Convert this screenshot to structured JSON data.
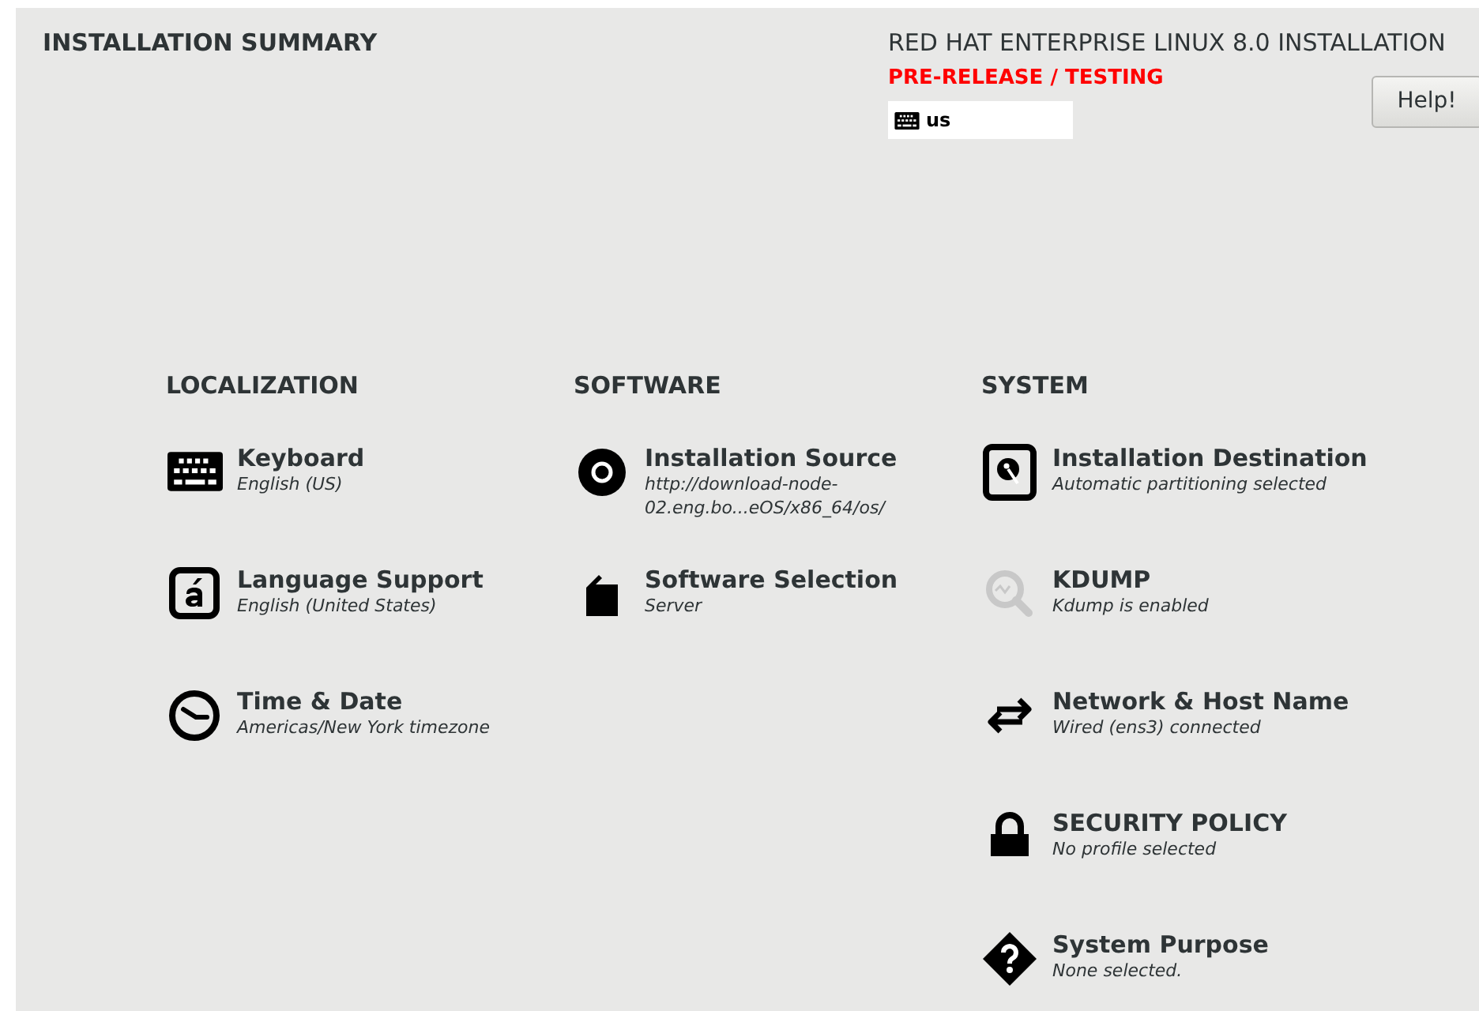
{
  "header": {
    "title": "INSTALLATION SUMMARY",
    "product": "RED HAT ENTERPRISE LINUX 8.0 INSTALLATION",
    "prerelease": "PRE-RELEASE / TESTING",
    "keyboard_layout": "us",
    "help_button": "Help!"
  },
  "categories": [
    {
      "title": "LOCALIZATION",
      "spokes": [
        {
          "kind": "keyboard",
          "title": "Keyboard",
          "status": "English (US)"
        },
        {
          "kind": "language",
          "title": "Language Support",
          "status": "English (United States)"
        },
        {
          "kind": "clock",
          "title": "Time & Date",
          "status": "Americas/New York timezone"
        }
      ]
    },
    {
      "title": "SOFTWARE",
      "spokes": [
        {
          "kind": "disc",
          "title": "Installation Source",
          "status": "http://download-node-02.eng.bo...eOS/x86_64/os/"
        },
        {
          "kind": "package",
          "title": "Software Selection",
          "status": "Server"
        }
      ]
    },
    {
      "title": "SYSTEM",
      "spokes": [
        {
          "kind": "disk",
          "title": "Installation Destination",
          "status": "Automatic partitioning selected"
        },
        {
          "kind": "kdump",
          "title": "KDUMP",
          "status": "Kdump is enabled"
        },
        {
          "kind": "network",
          "title": "Network & Host Name",
          "status": "Wired (ens3) connected"
        },
        {
          "kind": "lock",
          "title": "SECURITY POLICY",
          "status": "No profile selected"
        },
        {
          "kind": "purpose",
          "title": "System Purpose",
          "status": "None selected."
        }
      ]
    }
  ]
}
